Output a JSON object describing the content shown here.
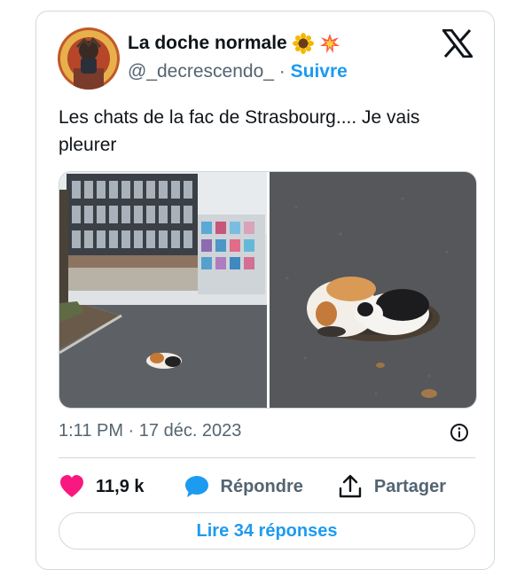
{
  "author": {
    "display_name": "La doche normale",
    "emojis": [
      "sunflower-emoji",
      "collision-emoji"
    ],
    "handle": "@_decrescendo_",
    "separator": "·",
    "follow_label": "Suivre"
  },
  "tweet": {
    "text": "Les chats de la fac de Strasbourg.... Je vais pleurer",
    "timestamp": "1:11 PM · 17 déc. 2023"
  },
  "media": [
    {
      "icon": "university-building-with-cat-photo"
    },
    {
      "icon": "cats-on-manhole-photo"
    }
  ],
  "actions": {
    "likes": "11,9 k",
    "reply_label": "Répondre",
    "share_label": "Partager"
  },
  "read_replies_label": "Lire 34 réponses",
  "colors": {
    "accent": "#1d9bf0",
    "heart": "#f91880",
    "muted": "#536471",
    "border": "#cfd9de",
    "text": "#0f1419"
  },
  "icons": [
    "x-logo-icon",
    "info-icon",
    "heart-icon",
    "reply-bubble-icon",
    "share-icon"
  ]
}
